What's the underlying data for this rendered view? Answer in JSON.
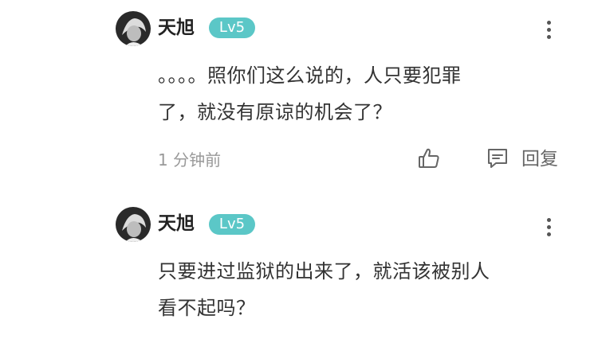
{
  "comments": [
    {
      "username": "天旭",
      "level": "Lv5",
      "content": "。。。。照你们这么说的，人只要犯罪\n了，就没有原谅的机会了？",
      "time": "1 分钟前",
      "reply_label": "回复"
    },
    {
      "username": "天旭",
      "level": "Lv5",
      "content": "只要进过监狱的出来了，就活该被别人\n看不起吗？"
    }
  ],
  "icons": {
    "more": "more-vertical-icon",
    "like": "thumbs-up-icon",
    "reply": "comment-icon"
  },
  "colors": {
    "level_badge": "#5bc7c7",
    "username": "#222222",
    "content": "#333333",
    "meta": "#999999"
  }
}
